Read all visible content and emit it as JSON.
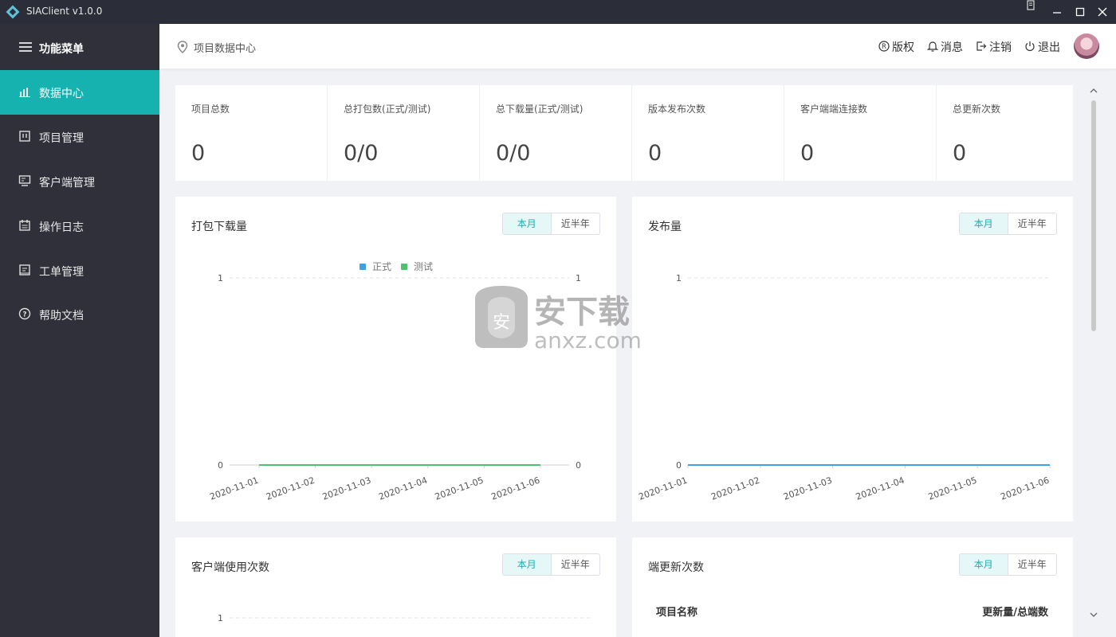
{
  "window": {
    "title": "SIAClient v1.0.0"
  },
  "sidebar": {
    "menu_title": "功能菜单",
    "items": [
      {
        "label": "数据中心",
        "icon": "bar-chart-icon",
        "active": true
      },
      {
        "label": "项目管理",
        "icon": "project-icon",
        "active": false
      },
      {
        "label": "客户端管理",
        "icon": "client-icon",
        "active": false
      },
      {
        "label": "操作日志",
        "icon": "calendar-icon",
        "active": false
      },
      {
        "label": "工单管理",
        "icon": "ticket-icon",
        "active": false
      },
      {
        "label": "帮助文档",
        "icon": "help-icon",
        "active": false
      }
    ]
  },
  "header": {
    "breadcrumb": "项目数据中心",
    "actions": [
      {
        "label": "版权",
        "icon": "registered-icon"
      },
      {
        "label": "消息",
        "icon": "bell-icon"
      },
      {
        "label": "注销",
        "icon": "logout-icon"
      },
      {
        "label": "退出",
        "icon": "power-icon"
      }
    ]
  },
  "stats": [
    {
      "title": "项目总数",
      "value": "0"
    },
    {
      "title": "总打包数(正式/测试)",
      "value": "0/0"
    },
    {
      "title": "总下载量(正式/测试)",
      "value": "0/0"
    },
    {
      "title": "版本发布次数",
      "value": "0"
    },
    {
      "title": "客户端端连接数",
      "value": "0"
    },
    {
      "title": "总更新次数",
      "value": "0"
    }
  ],
  "range_options": {
    "month": "本月",
    "half_year": "近半年"
  },
  "cards": {
    "download": {
      "title": "打包下载量"
    },
    "release": {
      "title": "发布量"
    },
    "usage": {
      "title": "客户端使用次数"
    },
    "updates": {
      "title": "端更新次数",
      "columns": [
        "项目名称",
        "更新量/总端数"
      ]
    }
  },
  "watermark": {
    "text": "安下载",
    "sub": "anxz.com"
  },
  "colors": {
    "accent": "#15b2b0",
    "sidebar_bg": "#2f3039",
    "titlebar_bg": "#2b2d38",
    "series_formal": "#3ba1e8",
    "series_test": "#4cc46f"
  },
  "chart_data": [
    {
      "type": "line",
      "title": "打包下载量",
      "categories": [
        "2020-11-01",
        "2020-11-02",
        "2020-11-03",
        "2020-11-04",
        "2020-11-05",
        "2020-11-06"
      ],
      "series": [
        {
          "name": "正式",
          "values": [
            0,
            0,
            0,
            0,
            0,
            0
          ],
          "color": "#3ba1e8"
        },
        {
          "name": "测试",
          "values": [
            0,
            0,
            0,
            0,
            0,
            0
          ],
          "color": "#4cc46f"
        }
      ],
      "ylim": [
        0,
        1
      ],
      "yticks": [
        "0",
        "1"
      ],
      "dual_axis": true,
      "legend": "top-center",
      "grid": true
    },
    {
      "type": "line",
      "title": "发布量",
      "categories": [
        "2020-11-01",
        "2020-11-02",
        "2020-11-03",
        "2020-11-04",
        "2020-11-05",
        "2020-11-06"
      ],
      "series": [
        {
          "values": [
            0,
            0,
            0,
            0,
            0,
            0
          ],
          "color": "#3ba1e8"
        }
      ],
      "ylim": [
        0,
        1
      ],
      "yticks": [
        "0",
        "1"
      ],
      "grid": true
    },
    {
      "type": "line",
      "title": "客户端使用次数",
      "yticks": [
        "1"
      ],
      "grid": true
    }
  ]
}
